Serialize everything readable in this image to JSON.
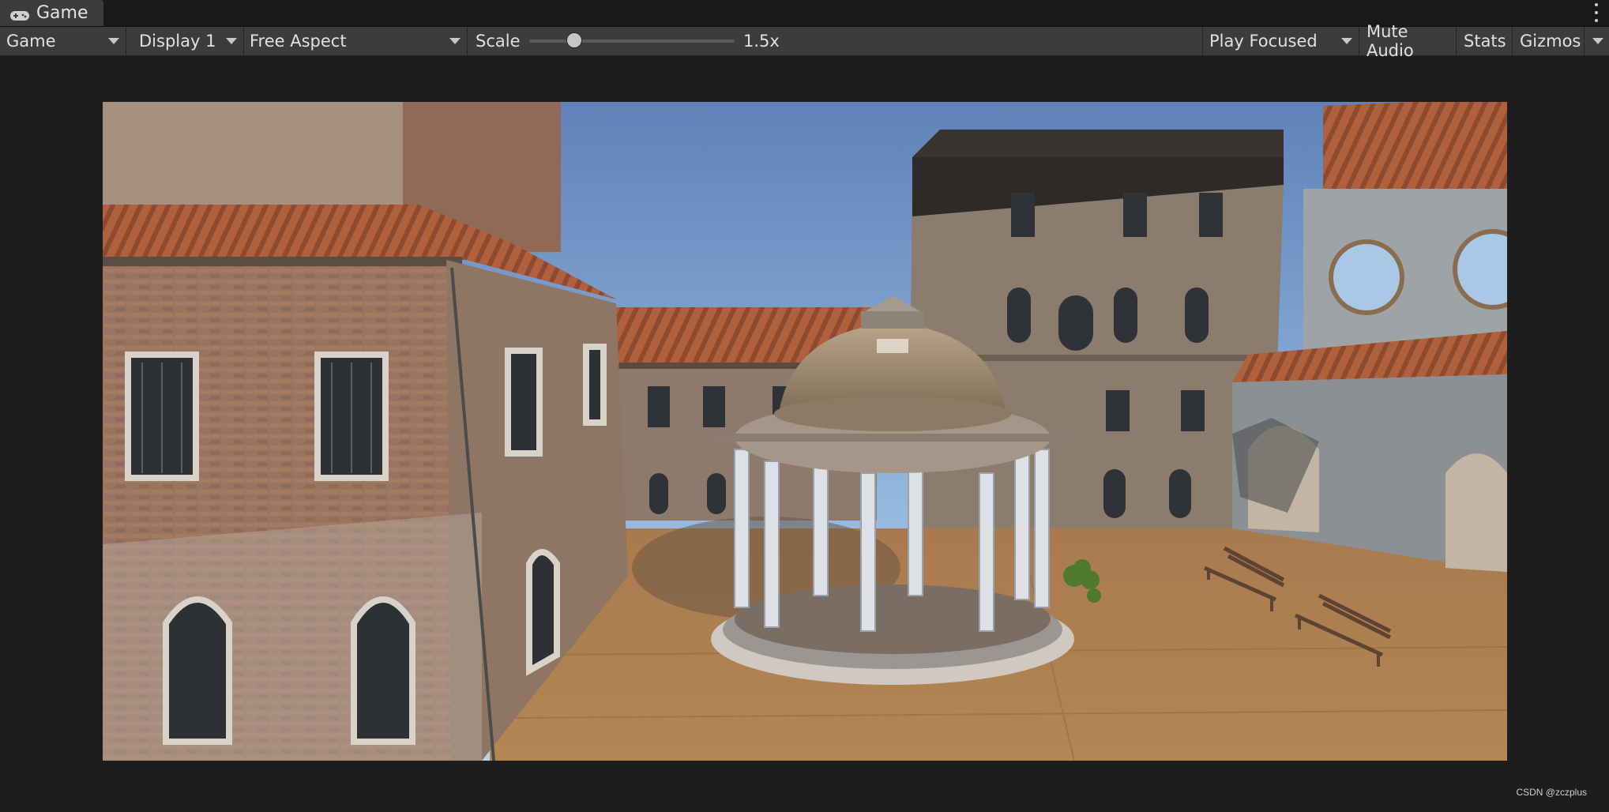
{
  "tab": {
    "label": "Game",
    "icon": "gamepad-icon"
  },
  "toolbar": {
    "view_mode": "Game",
    "display": "Display 1",
    "aspect": "Free Aspect",
    "scale_label": "Scale",
    "scale_value": "1.5x",
    "scale_slider_fraction": 0.22,
    "play_mode": "Play Focused",
    "mute_audio": "Mute Audio",
    "stats": "Stats",
    "gizmos": "Gizmos"
  },
  "watermark": "CSDN @zczplus",
  "colors": {
    "tab_active": "#3c3c3c",
    "toolbar_bg": "#3c3c3c",
    "window_bg": "#1d1d1d",
    "sky": "#6b8dbd"
  }
}
